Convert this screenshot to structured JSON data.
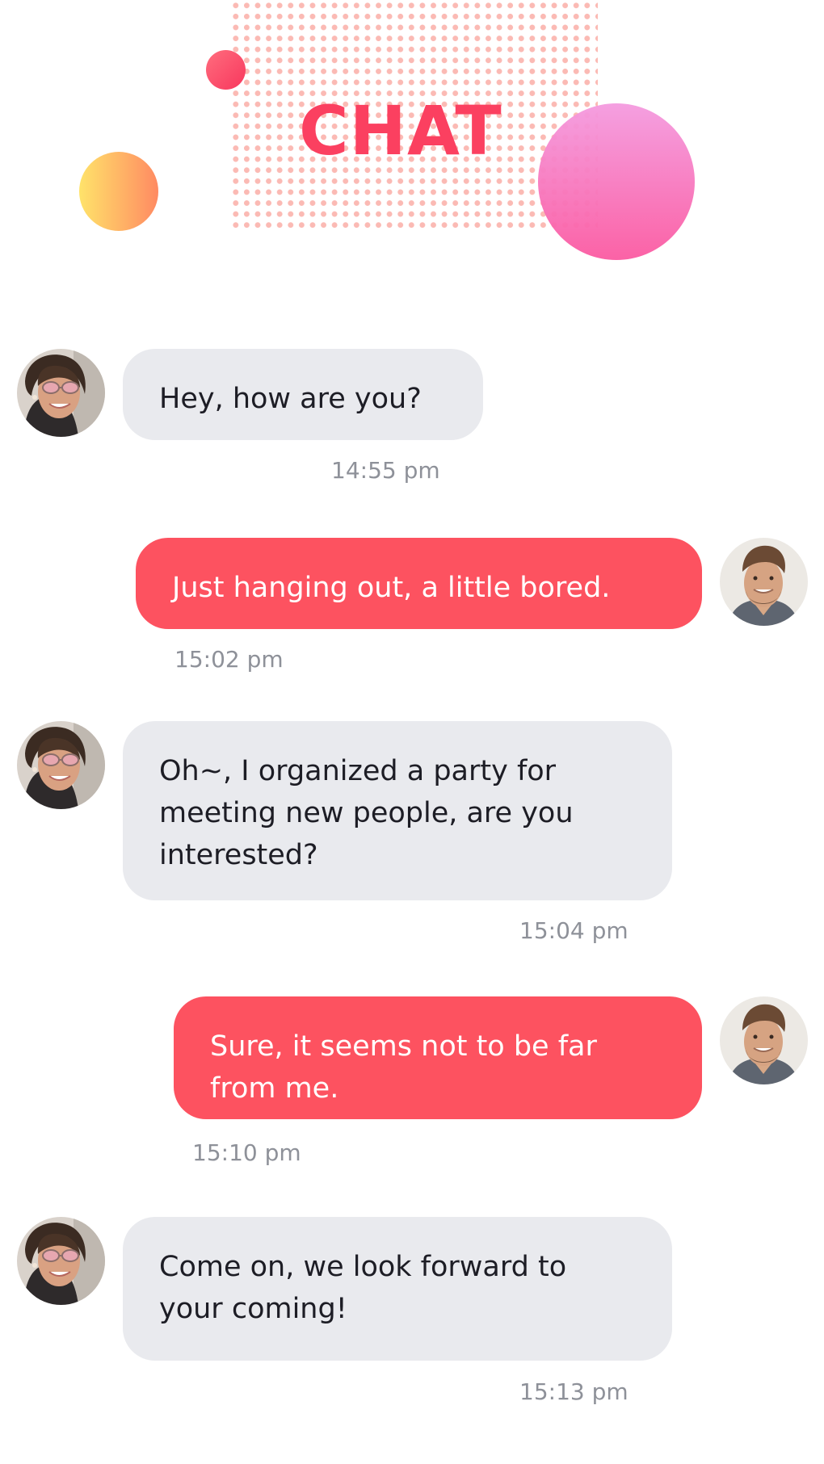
{
  "header": {
    "title": "CHAT"
  },
  "colors": {
    "accent": "#fb4060",
    "sent_bubble": "#fd5260",
    "received_bubble": "#e9eaee",
    "timestamp": "#8e9199"
  },
  "messages": [
    {
      "sender": "her",
      "text": "Hey, how are you?",
      "time": "14:55 pm"
    },
    {
      "sender": "me",
      "text": "Just hanging out, a little bored.",
      "time": "15:02 pm"
    },
    {
      "sender": "her",
      "text": "Oh~, I organized a party for\nmeeting new people, are you\ninterested?",
      "time": "15:04 pm"
    },
    {
      "sender": "me",
      "text": "Sure, it seems not to be far\nfrom me.",
      "time": "15:10 pm"
    },
    {
      "sender": "her",
      "text": "Come on, we look forward to\nyour coming!",
      "time": "15:13 pm"
    }
  ]
}
